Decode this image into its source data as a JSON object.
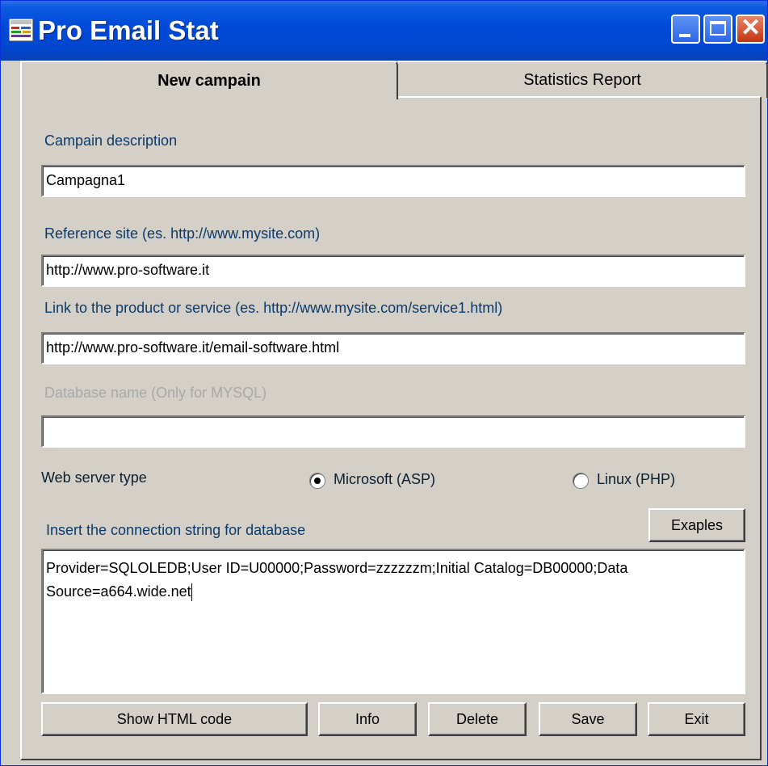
{
  "window": {
    "title": "Pro Email Stat",
    "accent": "#0049d6"
  },
  "titlebar_buttons": {
    "minimize_icon": "minimize-icon",
    "maximize_icon": "maximize-icon",
    "close_icon": "close-icon",
    "close_glyph": "✕"
  },
  "tabs": [
    {
      "label": "New campain",
      "active": true
    },
    {
      "label": "Statistics Report",
      "active": false
    }
  ],
  "form": {
    "description_label": "Campain description",
    "description_value": "Campagna1",
    "reference_label": "Reference site (es. http://www.mysite.com)",
    "reference_value": "http://www.pro-software.it",
    "link_label": "Link to the product or service (es. http://www.mysite.com/service1.html)",
    "link_value": "http://www.pro-software.it/email-software.html",
    "database_label": "Database name (Only for MYSQL)",
    "database_value": "",
    "server_type_label": "Web server type",
    "server_options": [
      {
        "label": "Microsoft (ASP)",
        "selected": true
      },
      {
        "label": "Linux (PHP)",
        "selected": false
      }
    ],
    "connection_label": "Insert the connection string for database",
    "examples_button": "Exaples",
    "connection_line1": "Provider=SQLOLEDB;User ID=U00000;Password=zzzzzzm;Initial Catalog=DB00000;Data",
    "connection_line2": "Source=a664.wide.net"
  },
  "buttons": {
    "show_html": "Show HTML code",
    "info": "Info",
    "delete": "Delete",
    "save": "Save",
    "exit": "Exit"
  }
}
